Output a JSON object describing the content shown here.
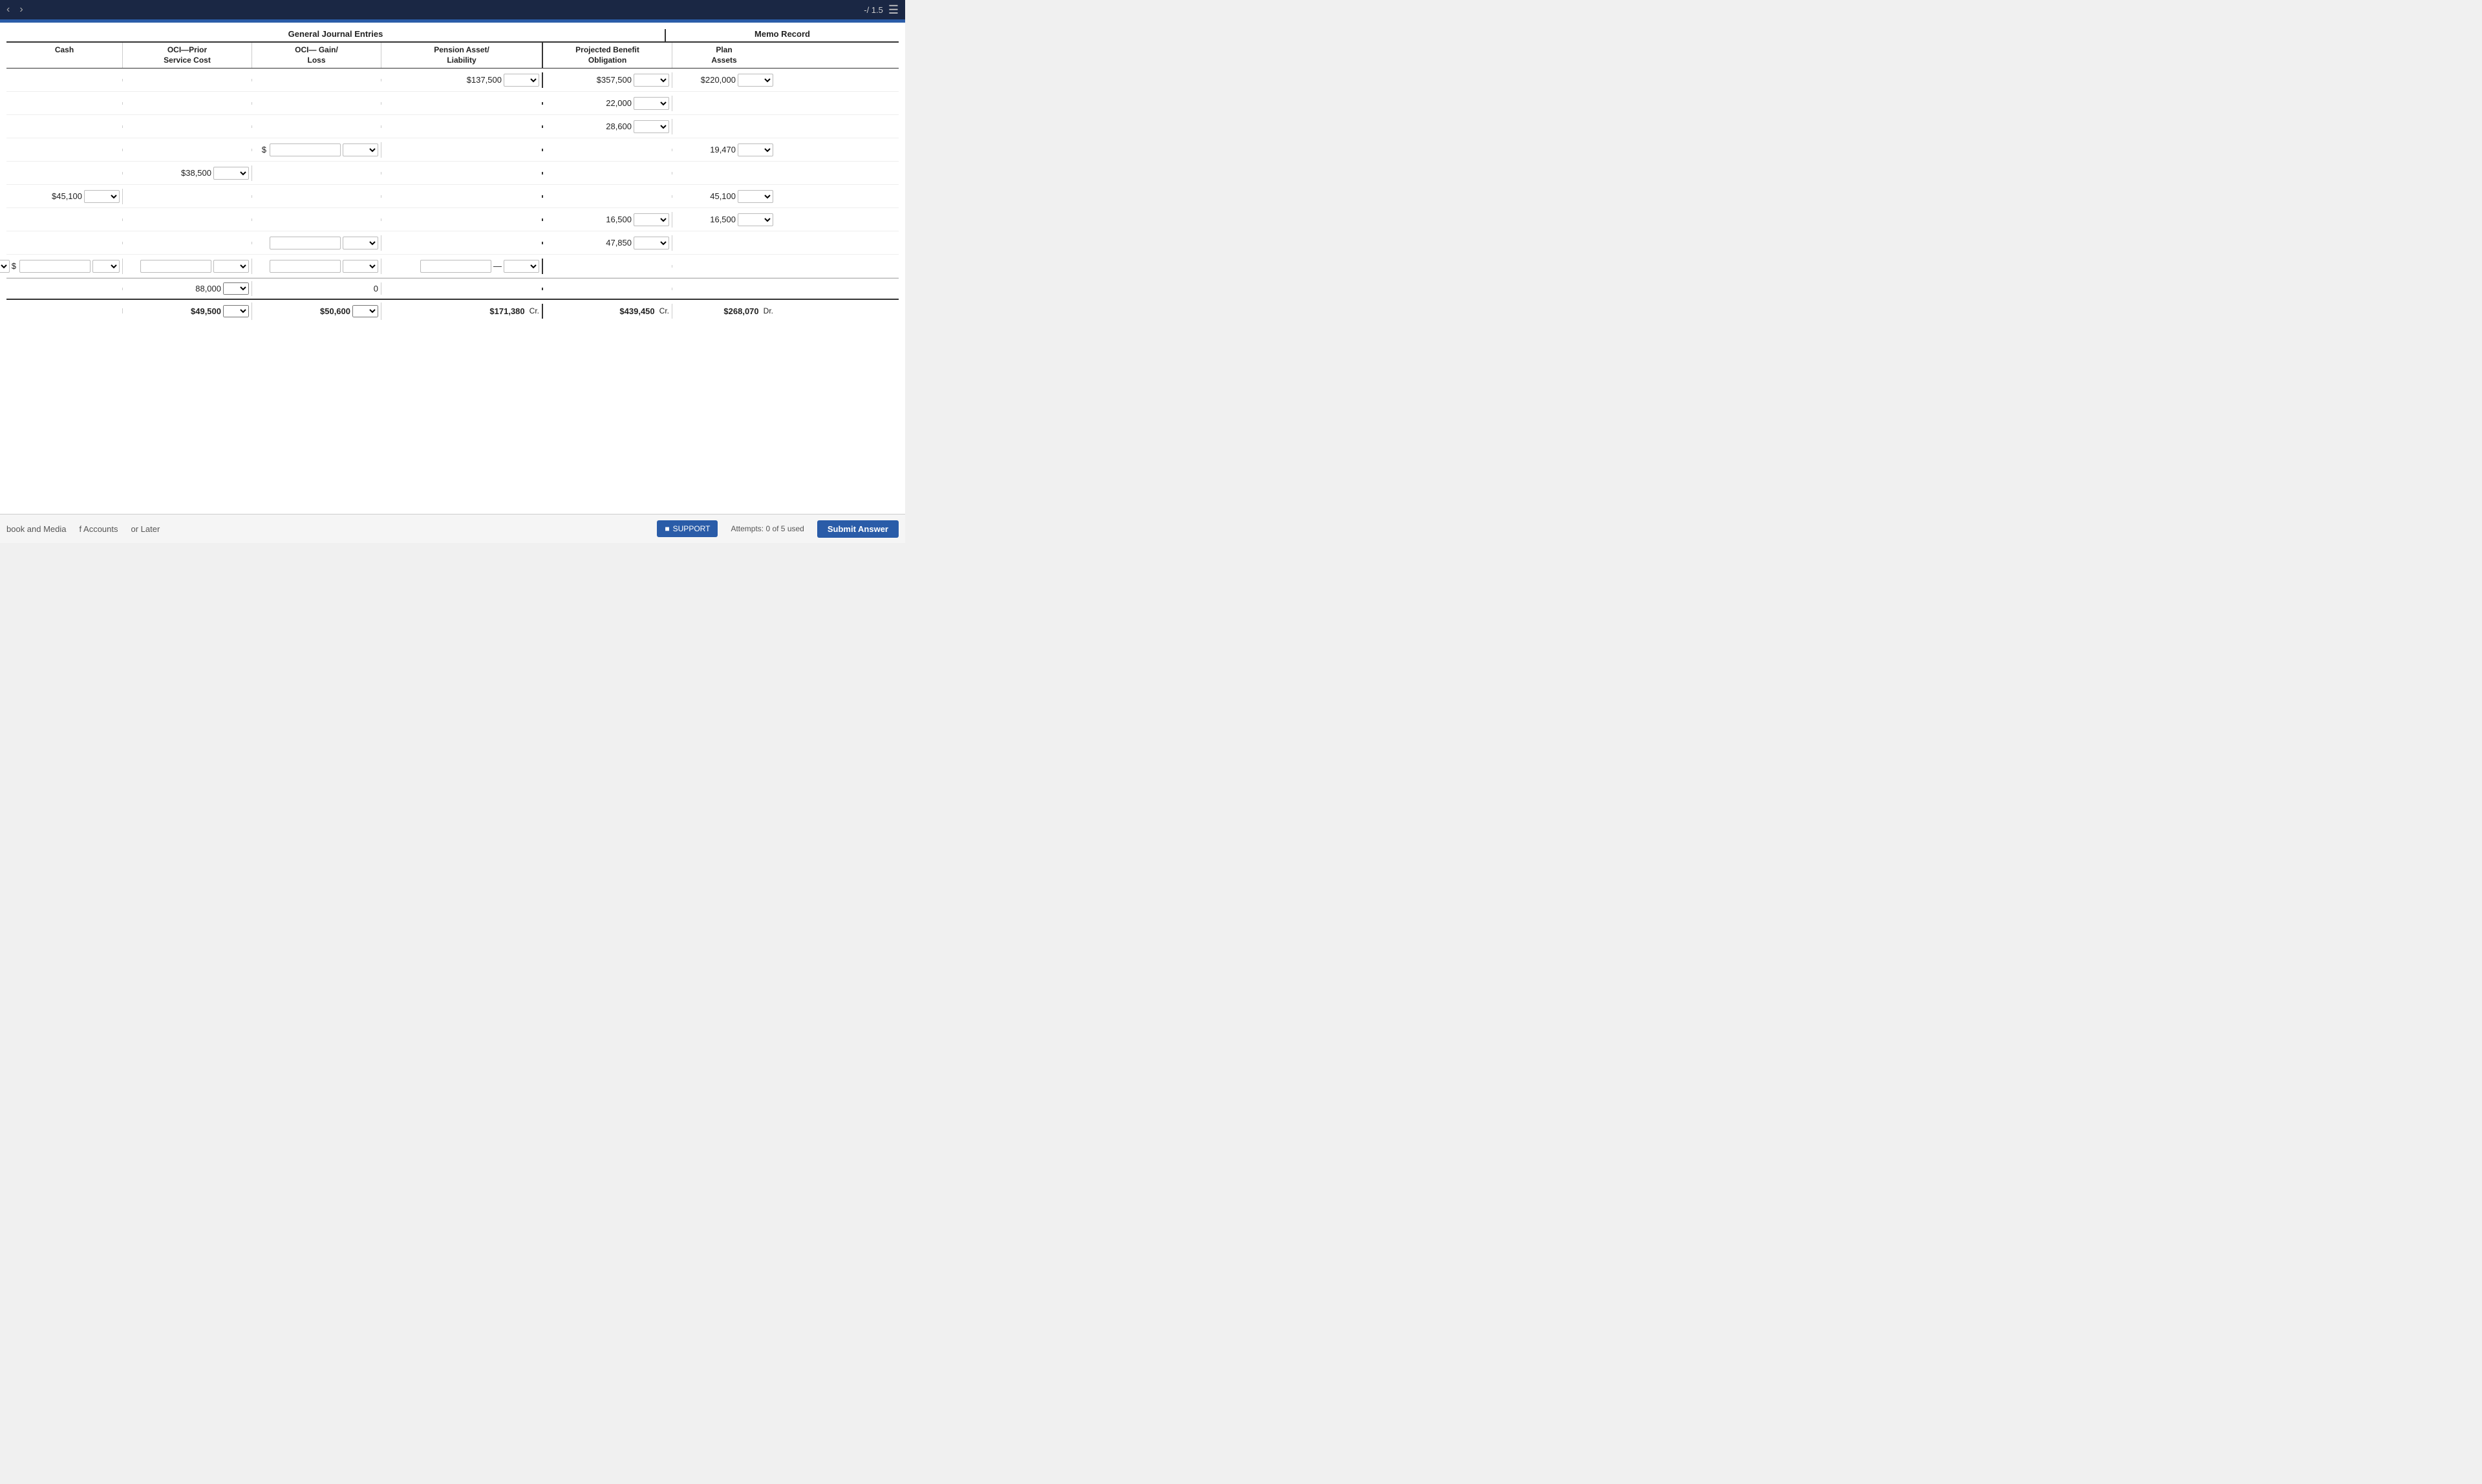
{
  "topbar": {
    "score": "-/ 1.5",
    "nav_back": "‹",
    "nav_forward": "›"
  },
  "headers": {
    "general_journal": "General Journal Entries",
    "memo_record": "Memo Record",
    "col_cash": "Cash",
    "col_oci_prior": "OCI—Prior\nService Cost",
    "col_oci_gain": "OCI— Gain/\nLoss",
    "col_pension": "Pension Asset/\nLiability",
    "col_pbo": "Projected Benefit\nObligation",
    "col_plan": "Plan\nAssets"
  },
  "rows": [
    {
      "cash": "",
      "cash_select": "",
      "oci_prior": "",
      "oci_prior_select": "",
      "oci_gain": "",
      "oci_gain_select": "",
      "pension": "137,500",
      "pension_select": "",
      "pbo": "357,500",
      "pbo_select": "",
      "plan": "220,000",
      "plan_select": ""
    },
    {
      "cash": "",
      "oci_prior": "",
      "oci_gain": "",
      "pension": "",
      "pbo": "22,000",
      "pbo_select": "",
      "plan": ""
    },
    {
      "cash": "",
      "oci_prior": "",
      "oci_gain": "",
      "pension": "",
      "pbo": "28,600",
      "pbo_select": "",
      "plan": ""
    },
    {
      "cash": "",
      "oci_prior": "",
      "oci_gain_input": true,
      "oci_gain_select": "",
      "pension": "",
      "pbo": "",
      "plan": "19,470",
      "plan_select": ""
    },
    {
      "cash": "",
      "oci_prior": "38,500",
      "oci_prior_select": "",
      "oci_gain": "",
      "pension": "",
      "pbo": "",
      "plan": ""
    },
    {
      "cash": "45,100",
      "cash_select": "",
      "oci_prior": "",
      "oci_gain": "",
      "pension": "",
      "pbo": "",
      "plan": "45,100",
      "plan_select": ""
    },
    {
      "cash": "",
      "oci_prior": "",
      "oci_gain": "",
      "pension": "",
      "pbo": "16,500",
      "pbo_select": "",
      "plan": "16,500",
      "plan_select": ""
    },
    {
      "cash": "",
      "oci_prior": "",
      "oci_gain_input2": true,
      "oci_gain_select2": "",
      "oci_gain2_select": "",
      "pension": "",
      "pbo": "47,850",
      "pbo_select": "",
      "plan": ""
    },
    {
      "cash_input": true,
      "cash_select": "",
      "oci_prior_input": true,
      "oci_prior_select": "",
      "oci_gain_input3": true,
      "oci_gain_select3": "",
      "pension_input": true,
      "pension_val": "—",
      "pension_select": "",
      "pbo": "",
      "plan": ""
    }
  ],
  "subtotals": {
    "oci_prior": "88,000",
    "oci_prior_select": "",
    "oci_gain": "0",
    "pension": "",
    "pbo": "",
    "plan": ""
  },
  "totals": {
    "cash": "",
    "oci_prior": "49,500",
    "oci_prior_select": "",
    "oci_gain": "50,600",
    "oci_gain_select": "",
    "pension": "171,380",
    "pension_label": "Cr.",
    "pbo": "439,450",
    "pbo_label": "Cr.",
    "plan": "268,070",
    "plan_label": "Dr."
  },
  "bottom": {
    "link1": "book and Media",
    "link2": "f Accounts",
    "link3": "or Later",
    "attempts": "Attempts: 0 of 5 used",
    "submit": "Submit Answer",
    "support": "SUPPORT"
  }
}
